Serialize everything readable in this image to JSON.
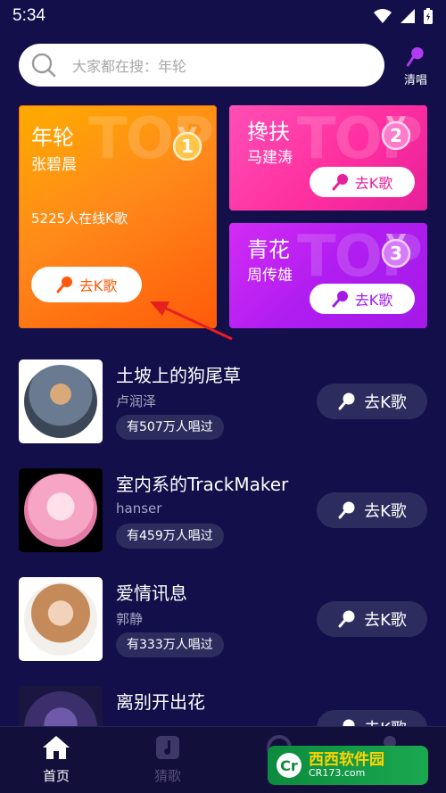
{
  "status_bar": {
    "time": "5:34"
  },
  "search": {
    "placeholder": "大家都在搜：年轮",
    "clear_label": "清唱"
  },
  "top_cards": [
    {
      "title": "年轮",
      "artist": "张碧晨",
      "online": "5225人在线K歌",
      "rank": "1",
      "button": "去K歌",
      "watermark": "TOP"
    },
    {
      "title": "搀扶",
      "artist": "马建涛",
      "rank": "2",
      "button": "去K歌",
      "watermark": "TOP"
    },
    {
      "title": "青花",
      "artist": "周传雄",
      "rank": "3",
      "button": "去K歌",
      "watermark": "TOP"
    }
  ],
  "songs": [
    {
      "title": "土坡上的狗尾草",
      "artist": "卢润泽",
      "sung": "有507万人唱过",
      "button": "去K歌"
    },
    {
      "title": "室内系的TrackMaker",
      "artist": "hanser",
      "sung": "有459万人唱过",
      "button": "去K歌"
    },
    {
      "title": "爱情讯息",
      "artist": "郭静",
      "sung": "有333万人唱过",
      "button": "去K歌"
    },
    {
      "title": "离别开出花",
      "artist": "",
      "sung": "",
      "button": "去K歌"
    }
  ],
  "nav": {
    "home": "首页",
    "guess": "猜歌",
    "third": "",
    "me": ""
  },
  "watermark_logo": {
    "brand": "西西软件园",
    "domain": "CR173.com"
  },
  "colors": {
    "background": "#120f4a",
    "card1": "#ff8a1a",
    "card2": "#ff2fa0",
    "card3": "#b01df0",
    "pill": "#2d2c5f"
  }
}
